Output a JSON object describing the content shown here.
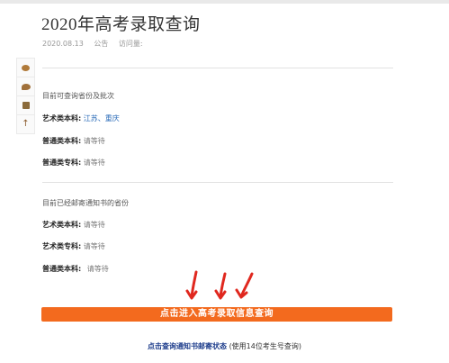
{
  "article": {
    "title": "2020年高考录取查询",
    "date": "2020.08.13",
    "category": "公告",
    "views_label": "访问量:"
  },
  "share": {
    "icons": [
      "weibo-icon",
      "wechat-icon",
      "qzone-icon",
      "back-to-top-icon"
    ]
  },
  "section1": {
    "heading": "目前可查询省份及批次",
    "rows": [
      {
        "label": "艺术类本科:",
        "value": "江苏、重庆"
      },
      {
        "label": "普通类本科:",
        "value": "请等待"
      },
      {
        "label": "普通类专科:",
        "value": "请等待"
      }
    ]
  },
  "section2": {
    "heading": "目前已经邮寄通知书的省份",
    "rows": [
      {
        "label": "艺术类本科:",
        "value": "请等待"
      },
      {
        "label": "艺术类专科:",
        "value": "请等待"
      },
      {
        "label": "普通类本科:",
        "value": "请等待"
      }
    ]
  },
  "cta": {
    "label": "点击进入高考录取信息查询"
  },
  "footer": {
    "link_text": "点击查询通知书邮寄状态",
    "note": "(使用14位考生号查询)"
  },
  "colors": {
    "accent": "#f36a1e",
    "arrow": "#e0281f",
    "link": "#1a3a8a",
    "highlight_value": "#2a6bb8"
  }
}
